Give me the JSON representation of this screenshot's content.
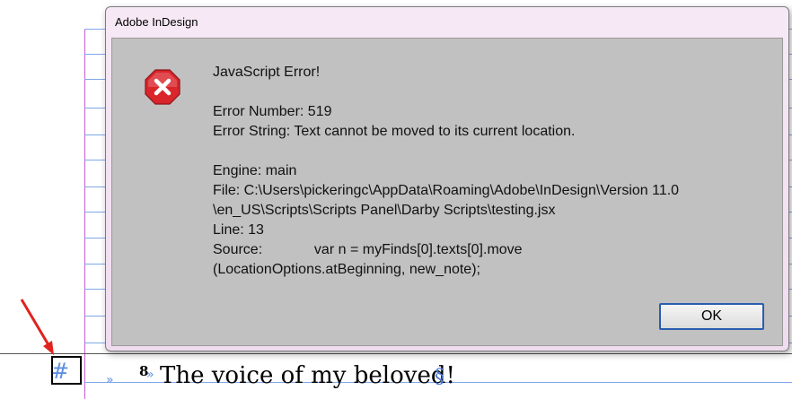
{
  "dialog": {
    "title": "Adobe InDesign",
    "heading": "JavaScript Error!",
    "error_number": "Error Number: 519",
    "error_string": "Error String: Text cannot be moved to its current location.",
    "engine": "Engine: main",
    "file_line1": "File: C:\\Users\\pickeringc\\AppData\\Roaming\\Adobe\\InDesign\\Version 11.0",
    "file_line2": "\\en_US\\Scripts\\Scripts Panel\\Darby Scripts\\testing.jsx",
    "line": "Line: 13",
    "source_line1": "Source:             var n = myFinds[0].texts[0].move",
    "source_line2": "(LocationOptions.atBeginning, new_note);",
    "ok_label": "OK",
    "icon": "error-icon"
  },
  "document": {
    "anchor_marker": "#",
    "verse_number": "8",
    "verse_text": "The voice of my beloved!",
    "tab_marker": "»",
    "end_marker": "§"
  },
  "colors": {
    "error_red": "#d9252b",
    "guide_blue": "#7fa7e8",
    "margin_magenta": "#c65bd6",
    "button_border": "#2a5db0",
    "arrow_red": "#e0231f"
  }
}
